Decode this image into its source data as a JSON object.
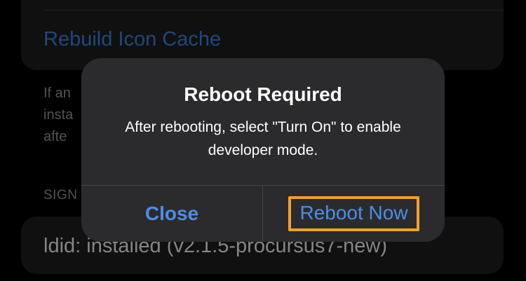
{
  "background": {
    "rebuild_icon_cache": "Rebuild Icon Cache",
    "footnote_lines": [
      "If an",
      "insta",
      "afte"
    ],
    "section_header": "SIGN",
    "ldid_status": "ldid: installed (v2.1.5-procursus7-new)"
  },
  "alert": {
    "title": "Reboot Required",
    "message": "After rebooting, select \"Turn On\" to enable developer mode.",
    "close_label": "Close",
    "reboot_label": "Reboot Now"
  },
  "colors": {
    "link_blue": "#4e8de6",
    "highlight_orange": "#f0a030",
    "alert_background": "#2b2b2d",
    "cell_background": "#1c1c1e"
  }
}
